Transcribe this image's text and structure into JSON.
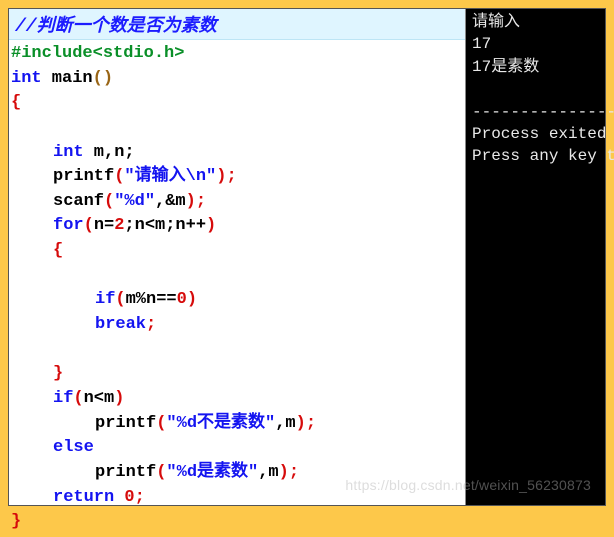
{
  "title_comment": "//判断一个数是否为素数",
  "code": {
    "include": "#include<stdio.h>",
    "int": "int",
    "main": " main",
    "op_paren": "(",
    "cl_paren": ")",
    "lbrace": "{",
    "decl_int": "int",
    "decl_vars": " m,n;",
    "printf": "printf",
    "op": "(",
    "cp": ")",
    "str1": "\"请输入\\n\"",
    "semi": ";",
    "scanf": "scanf",
    "str_d": "\"%d\"",
    "amp_m": ",&m",
    "for": "for",
    "for_open": "(",
    "for_n": "n=",
    "for_2": "2",
    "for_semi1": ";n<m;n++",
    "for_close": ")",
    "lbrace2": "{",
    "if": "if",
    "cond1": "(m%n==",
    "zero": "0",
    "cond1_close": ")",
    "break": "break",
    "rbrace2": "}",
    "if2": "if",
    "cond2": "(n<m)",
    "str2": "\"%d不是素数\"",
    "comma_m": ",m",
    "else": "else",
    "str3": "\"%d是素数\"",
    "return": "return",
    "zero_ret": " 0",
    "rbrace": "}"
  },
  "console": {
    "l1": "请输入",
    "l2": "17",
    "l3": "17是素数",
    "divider": "---------------",
    "l4": "Process exited ",
    "l5": "Press any key t"
  },
  "watermark": "https://blog.csdn.net/weixin_56230873"
}
